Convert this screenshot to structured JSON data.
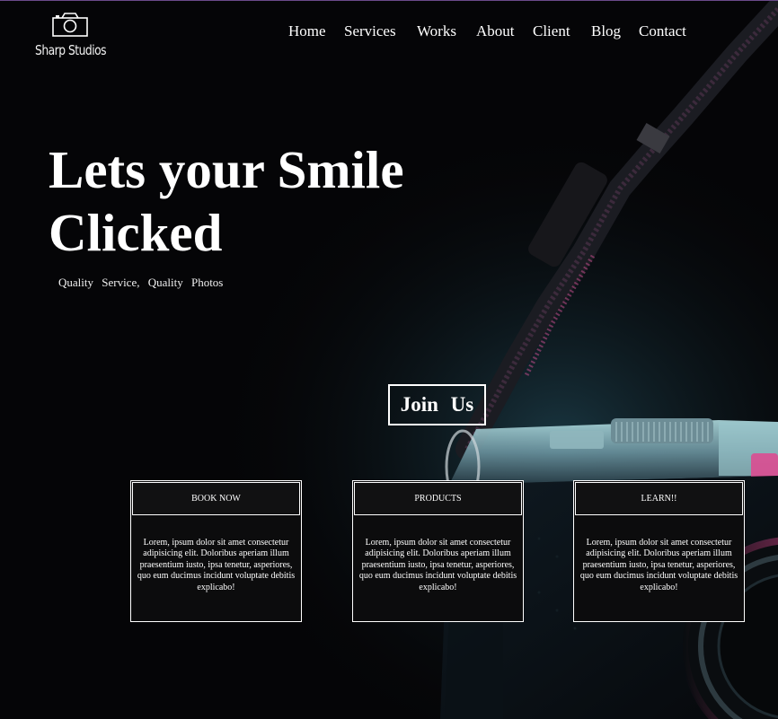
{
  "brand": {
    "name": "Sharp Studios",
    "logo_icon": "camera-icon"
  },
  "nav": {
    "items": [
      {
        "label": "Home"
      },
      {
        "label": "Services"
      },
      {
        "label": "Works"
      },
      {
        "label": "About"
      },
      {
        "label": "Client"
      },
      {
        "label": "Blog"
      },
      {
        "label": "Contact"
      }
    ]
  },
  "hero": {
    "title_line1": "Lets your Smile",
    "title_line2": "Clicked",
    "subtitle": "Quality Service, Quality Photos",
    "cta_label": "Join Us"
  },
  "cards": [
    {
      "title": "BOOK NOW",
      "text": "Lorem, ipsum dolor sit amet consectetur adipisicing elit. Doloribus aperiam illum praesentium iusto, ipsa tenetur, asperiores, quo eum ducimus incidunt voluptate debitis explicabo!"
    },
    {
      "title": "PRODUCTS",
      "text": "Lorem, ipsum dolor sit amet consectetur adipisicing elit. Doloribus aperiam illum praesentium iusto, ipsa tenetur, asperiores, quo eum ducimus incidunt voluptate debitis explicabo!"
    },
    {
      "title": "LEARN!!",
      "text": "Lorem, ipsum dolor sit amet consectetur adipisicing elit. Doloribus aperiam illum praesentium iusto, ipsa tenetur, asperiores, quo eum ducimus incidunt voluptate debitis explicabo!"
    }
  ],
  "colors": {
    "background": "#050507",
    "accent_pink": "#e0468f",
    "accent_teal": "#7fd3d9",
    "text": "#ffffff"
  }
}
